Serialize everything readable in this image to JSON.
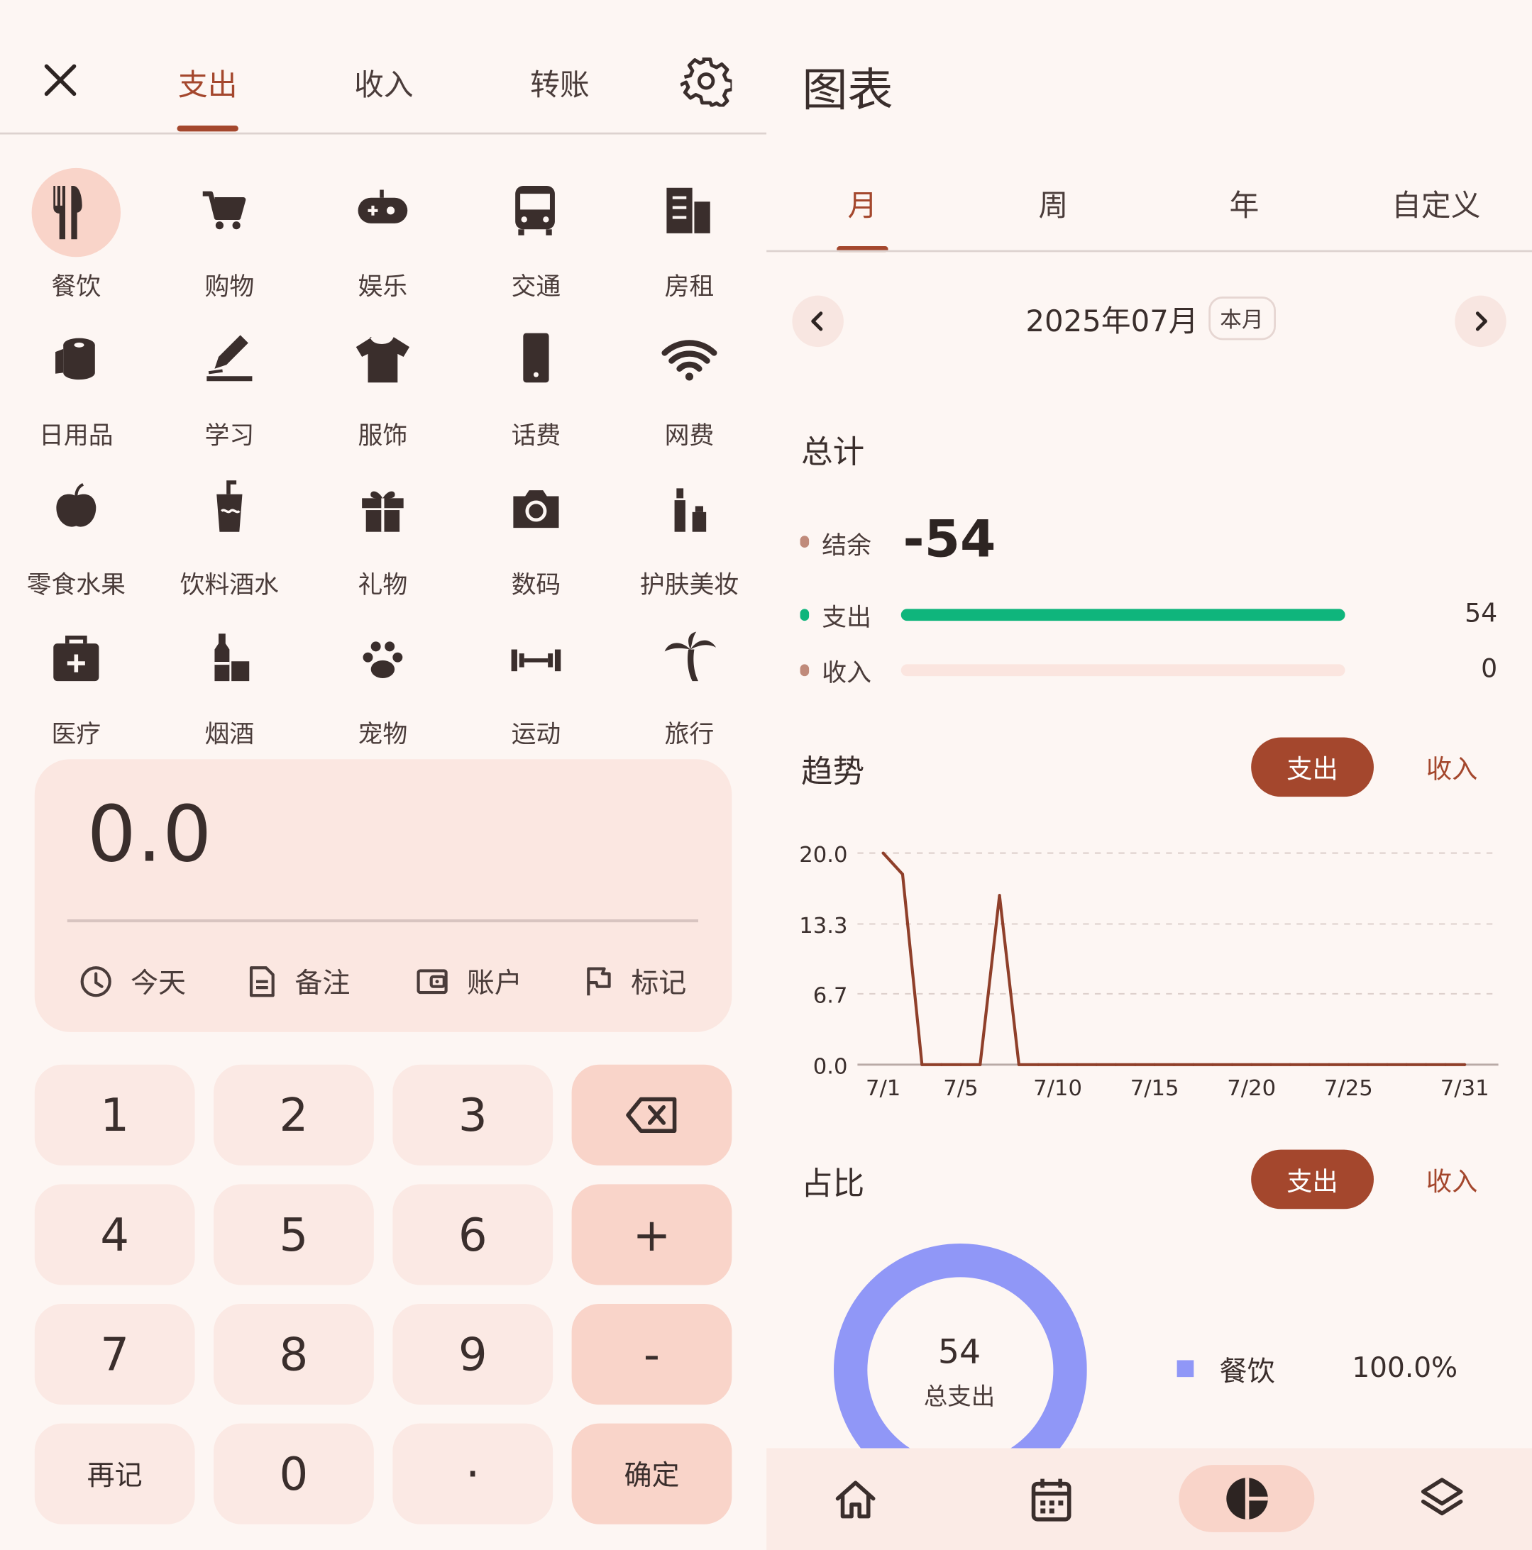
{
  "left": {
    "tabs": [
      "支出",
      "收入",
      "转账"
    ],
    "active_tab": "支出",
    "categories": [
      {
        "label": "餐饮",
        "icon": "fork-knife-icon",
        "selected": true
      },
      {
        "label": "购物",
        "icon": "cart-icon"
      },
      {
        "label": "娱乐",
        "icon": "gamepad-icon"
      },
      {
        "label": "交通",
        "icon": "bus-icon"
      },
      {
        "label": "房租",
        "icon": "building-icon"
      },
      {
        "label": "日用品",
        "icon": "tissue-roll-icon"
      },
      {
        "label": "学习",
        "icon": "pencil-icon"
      },
      {
        "label": "服饰",
        "icon": "tshirt-icon"
      },
      {
        "label": "话费",
        "icon": "phone-icon"
      },
      {
        "label": "网费",
        "icon": "wifi-icon"
      },
      {
        "label": "零食水果",
        "icon": "apple-icon"
      },
      {
        "label": "饮料酒水",
        "icon": "drink-cup-icon"
      },
      {
        "label": "礼物",
        "icon": "gift-icon"
      },
      {
        "label": "数码",
        "icon": "camera-icon"
      },
      {
        "label": "护肤美妆",
        "icon": "cosmetics-icon"
      },
      {
        "label": "医疗",
        "icon": "medical-kit-icon"
      },
      {
        "label": "烟酒",
        "icon": "bottle-icon"
      },
      {
        "label": "宠物",
        "icon": "paw-icon"
      },
      {
        "label": "运动",
        "icon": "dumbbell-icon"
      },
      {
        "label": "旅行",
        "icon": "palm-tree-icon"
      }
    ],
    "amount": "0.0",
    "actions": [
      {
        "label": "今天",
        "icon": "clock-icon"
      },
      {
        "label": "备注",
        "icon": "note-icon"
      },
      {
        "label": "账户",
        "icon": "wallet-icon"
      },
      {
        "label": "标记",
        "icon": "flag-icon"
      }
    ],
    "keys": [
      [
        "1",
        "2",
        "3",
        "⌫"
      ],
      [
        "4",
        "5",
        "6",
        "+"
      ],
      [
        "7",
        "8",
        "9",
        "-"
      ],
      [
        "再记",
        "0",
        "·",
        "确定"
      ]
    ]
  },
  "right": {
    "title": "图表",
    "tabs": [
      "月",
      "周",
      "年",
      "自定义"
    ],
    "active_tab": "月",
    "month_label": "2025年07月",
    "month_badge": "本月",
    "summary": {
      "title": "总计",
      "balance_label": "结余",
      "balance": "-54",
      "expense_label": "支出",
      "expense": "54",
      "expense_fraction": 1.0,
      "income_label": "收入",
      "income": "0",
      "income_fraction": 0.0
    },
    "trend": {
      "title": "趋势",
      "toggle_on": "支出",
      "toggle_off": "收入"
    },
    "share": {
      "title": "占比",
      "toggle_on": "支出",
      "toggle_off": "收入",
      "center_value": "54",
      "center_label": "总支出",
      "legend": [
        {
          "label": "餐饮",
          "percent": "100.0%",
          "color": "#9097f7"
        }
      ]
    },
    "bottom_nav": [
      "home-icon",
      "calendar-icon",
      "pie-chart-icon",
      "layers-icon"
    ],
    "colors": {
      "accent": "#a4472d",
      "expense_bar": "#0fb57c",
      "donut": "#9097f7"
    }
  },
  "chart_data": {
    "type": "line",
    "x": [
      1,
      2,
      3,
      4,
      5,
      6,
      7,
      8,
      9,
      10,
      11,
      12,
      13,
      14,
      15,
      16,
      17,
      18,
      19,
      20,
      21,
      22,
      23,
      24,
      25,
      26,
      27,
      28,
      29,
      30,
      31
    ],
    "x_tick_labels": [
      "7/1",
      "7/5",
      "7/10",
      "7/15",
      "7/20",
      "7/25",
      "7/31"
    ],
    "x_ticks": [
      1,
      5,
      10,
      15,
      20,
      25,
      31
    ],
    "y_tick_labels": [
      "20.0",
      "13.3",
      "6.7",
      "0.0"
    ],
    "y_ticks": [
      20.0,
      13.3,
      6.7,
      0.0
    ],
    "ylim": [
      0,
      20
    ],
    "series": [
      {
        "values": [
          20,
          18,
          0,
          0,
          0,
          0,
          16,
          0,
          0,
          0,
          0,
          0,
          0,
          0,
          0,
          0,
          0,
          0,
          0,
          0,
          0,
          0,
          0,
          0,
          0,
          0,
          0,
          0,
          0,
          0,
          0
        ],
        "color": "#8f3f2a"
      }
    ],
    "grid": "horizontal-dashed"
  }
}
